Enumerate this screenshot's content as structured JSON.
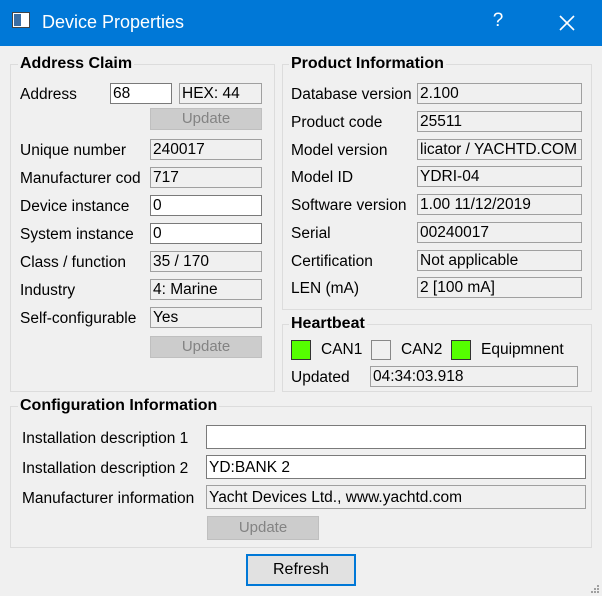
{
  "window": {
    "title": "Device Properties",
    "help": "?"
  },
  "address_claim": {
    "title": "Address Claim",
    "address_label": "Address",
    "address_value": "68",
    "hex_value": "HEX: 44",
    "update_top": "Update",
    "rows": [
      {
        "label": "Unique number",
        "value": "240017"
      },
      {
        "label": "Manufacturer cod",
        "value": "717"
      },
      {
        "label": "Device instance",
        "value": "0"
      },
      {
        "label": "System instance",
        "value": "0"
      },
      {
        "label": "Class / function",
        "value": "35 / 170"
      },
      {
        "label": "Industry",
        "value": "4: Marine"
      },
      {
        "label": "Self-configurable",
        "value": "Yes"
      }
    ],
    "update_bottom": "Update"
  },
  "product_info": {
    "title": "Product Information",
    "rows": [
      {
        "label": "Database version",
        "value": "2.100"
      },
      {
        "label": "Product code",
        "value": "25511"
      },
      {
        "label": "Model version",
        "value": "licator / YACHTD.COM"
      },
      {
        "label": "Model ID",
        "value": "YDRI-04"
      },
      {
        "label": "Software version",
        "value": "1.00 11/12/2019"
      },
      {
        "label": "Serial",
        "value": "00240017"
      },
      {
        "label": "Certification",
        "value": "Not applicable"
      },
      {
        "label": "LEN (mA)",
        "value": "2 [100 mA]"
      }
    ]
  },
  "heartbeat": {
    "title": "Heartbeat",
    "indicators": [
      {
        "label": "CAN1",
        "color": "#55ff00"
      },
      {
        "label": "CAN2",
        "color": "#f0f0f0"
      },
      {
        "label": "Equipmnent",
        "color": "#55ff00"
      }
    ],
    "updated_label": "Updated",
    "updated_value": "04:34:03.918"
  },
  "config_info": {
    "title": "Configuration Information",
    "rows": [
      {
        "label": "Installation description 1",
        "value": ""
      },
      {
        "label": "Installation description 2",
        "value": "YD:BANK 2"
      },
      {
        "label": "Manufacturer information",
        "value": "Yacht Devices Ltd., www.yachtd.com"
      }
    ],
    "update": "Update"
  },
  "refresh_label": "Refresh"
}
